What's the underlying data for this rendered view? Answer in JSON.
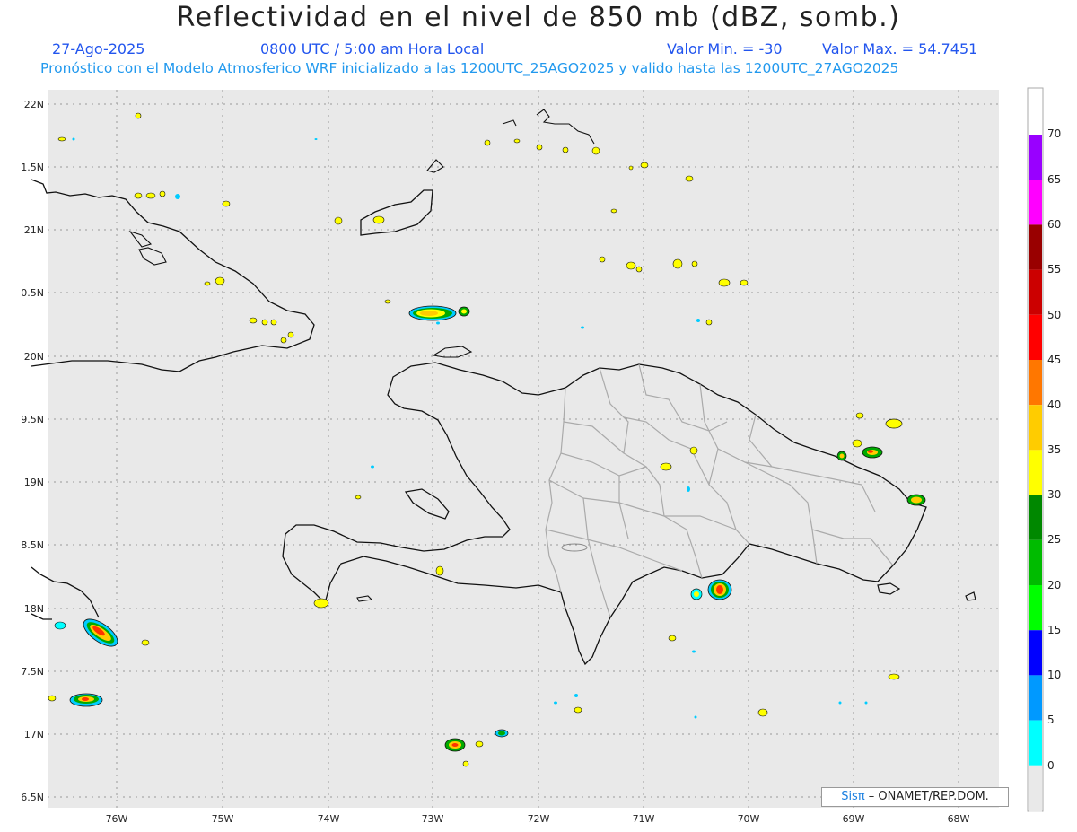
{
  "header": {
    "title": "Reflectividad en el nivel de 850 mb (dBZ, somb.)",
    "date": "27-Ago-2025",
    "time": "0800 UTC / 5:00 am Hora Local",
    "valmin": "Valor Min. = -30",
    "valmax": "Valor Max. = 54.7451",
    "info": "Pronóstico con el Modelo Atmosferico WRF inicializado a las 1200UTC_25AGO2025 y valido hasta las  1200UTC_27AGO2025"
  },
  "map": {
    "lat_labels": [
      "22N",
      "1.5N",
      "21N",
      "0.5N",
      "20N",
      "9.5N",
      "19N",
      "8.5N",
      "18N",
      "7.5N",
      "17N",
      "6.5N"
    ],
    "lon_labels": [
      "76W",
      "75W",
      "74W",
      "73W",
      "72W",
      "71W",
      "70W",
      "69W",
      "68W"
    ],
    "background_color": "#e9e9e9"
  },
  "colorbar": {
    "labels": [
      "70",
      "65",
      "60",
      "55",
      "50",
      "45",
      "40",
      "35",
      "30",
      "25",
      "20",
      "15",
      "10",
      "5",
      "0"
    ],
    "colors": [
      "#9900ff",
      "#ff00ff",
      "#990000",
      "#cc0000",
      "#ff0000",
      "#ff7700",
      "#ffcc00",
      "#ffff00",
      "#008800",
      "#00bb00",
      "#00ff00",
      "#0000ff",
      "#0099ff",
      "#00ffff",
      "#e9e9e9"
    ]
  },
  "credit": {
    "brand": "Sisπ",
    "text": " – ONAMET/REP.DOM."
  }
}
